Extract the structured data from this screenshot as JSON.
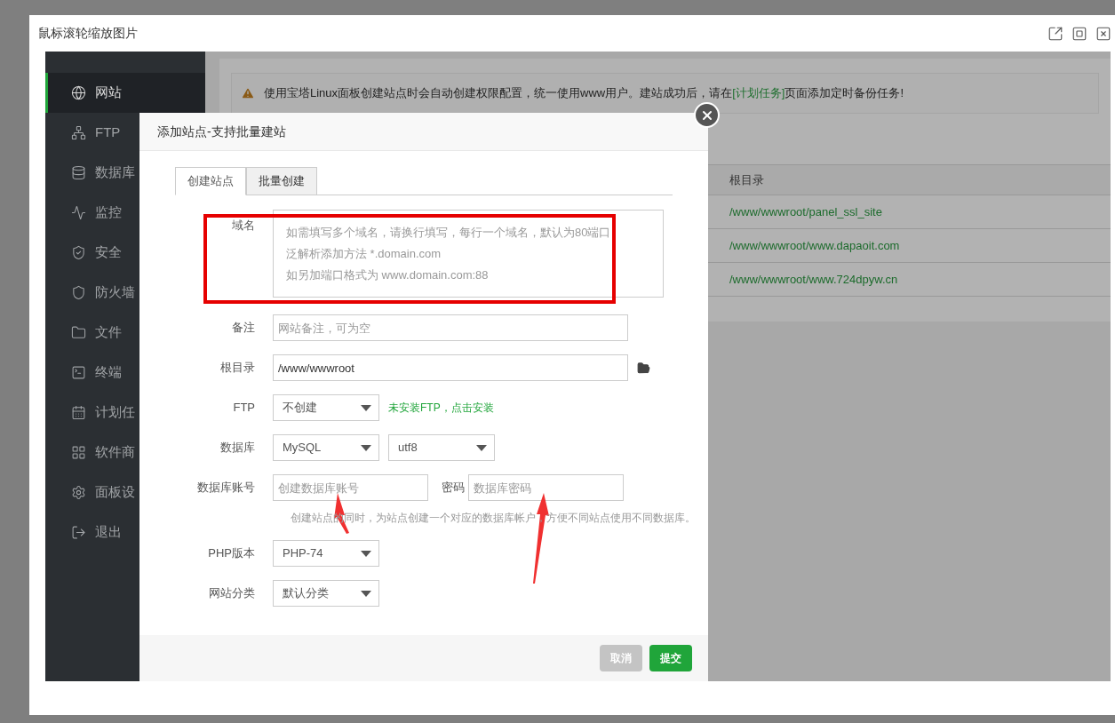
{
  "viewer": {
    "title": "鼠标滚轮缩放图片"
  },
  "sidebar": {
    "items": [
      {
        "label": "网站",
        "selected": true
      },
      {
        "label": "FTP",
        "selected": false
      },
      {
        "label": "数据库",
        "selected": false
      },
      {
        "label": "监控",
        "selected": false
      },
      {
        "label": "安全",
        "selected": false
      },
      {
        "label": "防火墙",
        "selected": false
      },
      {
        "label": "文件",
        "selected": false
      },
      {
        "label": "终端",
        "selected": false
      },
      {
        "label": "计划任",
        "selected": false
      },
      {
        "label": "软件商",
        "selected": false
      },
      {
        "label": "面板设",
        "selected": false
      },
      {
        "label": "退出",
        "selected": false
      }
    ]
  },
  "notice": {
    "text": "使用宝塔Linux面板创建站点时会自动创建权限配置，统一使用www用户。建站成功后，请在",
    "link": "[计划任务]",
    "text_after": "页面添加定时备份任务!"
  },
  "table": {
    "column_header": "根目录",
    "rows": [
      "/www/wwwroot/panel_ssl_site",
      "/www/wwwroot/www.dapaoit.com",
      "/www/wwwroot/www.724dpyw.cn"
    ]
  },
  "dialog": {
    "title": "添加站点-支持批量建站",
    "tabs": [
      {
        "label": "创建站点",
        "selected": true
      },
      {
        "label": "批量创建",
        "selected": false
      }
    ],
    "domain": {
      "label": "域名",
      "placeholder_lines": [
        "如需填写多个域名，请换行填写，每行一个域名，默认为80端口",
        "泛解析添加方法 *.domain.com",
        "如另加端口格式为 www.domain.com:88"
      ]
    },
    "remark": {
      "label": "备注",
      "placeholder": "网站备注，可为空"
    },
    "root": {
      "label": "根目录",
      "value": "/www/wwwroot"
    },
    "ftp": {
      "label": "FTP",
      "value": "不创建",
      "hint": "未安装FTP，点击安装"
    },
    "database": {
      "label": "数据库",
      "type": "MySQL",
      "charset": "utf8"
    },
    "db_account": {
      "label": "数据库账号",
      "placeholder": "创建数据库账号",
      "password_label": "密码",
      "password_placeholder": "数据库密码",
      "help": "创建站点的同时，为站点创建一个对应的数据库帐户，方便不同站点使用不同数据库。"
    },
    "php": {
      "label": "PHP版本",
      "value": "PHP-74"
    },
    "category": {
      "label": "网站分类",
      "value": "默认分类"
    },
    "buttons": [
      {
        "label": "取消",
        "kind": "cancel"
      },
      {
        "label": "提交",
        "kind": "submit"
      }
    ]
  }
}
